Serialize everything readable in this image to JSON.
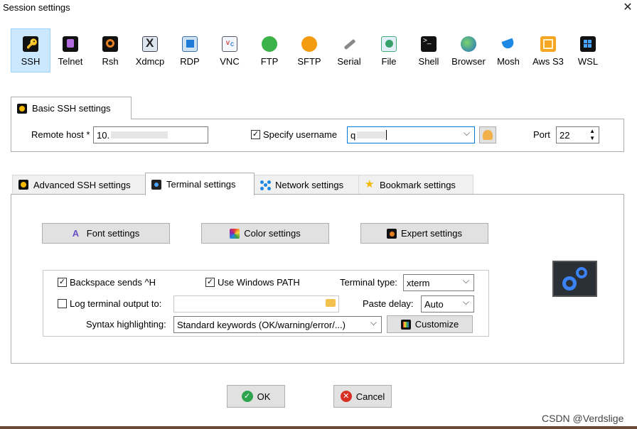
{
  "window": {
    "title": "Session settings",
    "close_glyph": "✕"
  },
  "protocols": [
    {
      "label": "SSH",
      "icon": "ssh-key-icon",
      "selected": true
    },
    {
      "label": "Telnet",
      "icon": "telnet-icon"
    },
    {
      "label": "Rsh",
      "icon": "rsh-icon"
    },
    {
      "label": "Xdmcp",
      "icon": "xdmcp-icon"
    },
    {
      "label": "RDP",
      "icon": "rdp-icon"
    },
    {
      "label": "VNC",
      "icon": "vnc-icon"
    },
    {
      "label": "FTP",
      "icon": "ftp-icon"
    },
    {
      "label": "SFTP",
      "icon": "sftp-icon"
    },
    {
      "label": "Serial",
      "icon": "serial-icon"
    },
    {
      "label": "File",
      "icon": "file-icon"
    },
    {
      "label": "Shell",
      "icon": "shell-icon"
    },
    {
      "label": "Browser",
      "icon": "browser-icon"
    },
    {
      "label": "Mosh",
      "icon": "mosh-icon"
    },
    {
      "label": "Aws S3",
      "icon": "aws-s3-icon"
    },
    {
      "label": "WSL",
      "icon": "wsl-icon"
    }
  ],
  "basic": {
    "tab_label": "Basic SSH settings",
    "remote_host_label": "Remote host *",
    "remote_host_value": "10.",
    "specify_username_label": "Specify username",
    "specify_username_checked": true,
    "username_value": "q",
    "port_label": "Port",
    "port_value": "22"
  },
  "tabs": [
    {
      "label": "Advanced SSH settings",
      "icon": "wrench-icon"
    },
    {
      "label": "Terminal settings",
      "icon": "terminal-gear-icon",
      "selected": true
    },
    {
      "label": "Network settings",
      "icon": "network-icon"
    },
    {
      "label": "Bookmark settings",
      "icon": "star-icon"
    }
  ],
  "terminal": {
    "font_settings": "Font settings",
    "color_settings": "Color settings",
    "expert_settings": "Expert settings",
    "backspace_label": "Backspace sends ^H",
    "backspace_checked": true,
    "use_windows_path_label": "Use Windows PATH",
    "use_windows_path_checked": true,
    "terminal_type_label": "Terminal type:",
    "terminal_type_value": "xterm",
    "log_output_label": "Log terminal output to:",
    "log_output_checked": false,
    "log_output_value": "",
    "paste_delay_label": "Paste delay:",
    "paste_delay_value": "Auto",
    "syntax_label": "Syntax highlighting:",
    "syntax_value": "Standard keywords (OK/warning/error/...)",
    "customize_label": "Customize"
  },
  "footer": {
    "ok_label": "OK",
    "cancel_label": "Cancel"
  },
  "watermark": "CSDN @Verdslige",
  "colors": {
    "selection_bg": "#cce8ff",
    "button_bg": "#e1e1e1",
    "ok_green": "#2ea44f",
    "cancel_red": "#d93025",
    "gear_blue": "#3b82f6"
  }
}
